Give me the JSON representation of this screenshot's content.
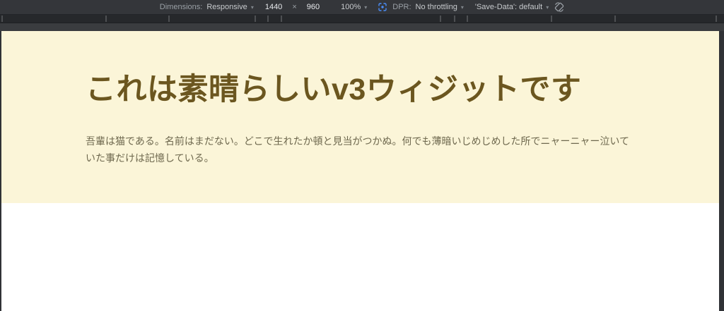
{
  "toolbar": {
    "dimensions_label": "Dimensions:",
    "dimensions_value": "Responsive",
    "width_value": "1440",
    "times_symbol": "×",
    "height_value": "960",
    "zoom_value": "100%",
    "dpr_label": "DPR:",
    "throttling_value": "No throttling",
    "save_data_value": "'Save-Data': default"
  },
  "icons": {
    "chevron_down": "▾",
    "focus_icon_name": "focus-icon",
    "rotate_icon_name": "rotate-viewport-icon"
  },
  "page": {
    "heading": "これは素晴らしいv3ウィジットです",
    "paragraph": "吾輩は猫である。名前はまだない。どこで生れたか頓と見当がつかぬ。何でも薄暗いじめじめした所でニャーニャー泣いていた事だけは記憶している。"
  },
  "colors": {
    "toolbar_bg": "#34363a",
    "toolbar_text": "#9aa0a6",
    "toolbar_value_text": "#e8eaed",
    "tabstrip_bg": "#26282b",
    "subbar_bg": "#3a3c3f",
    "accent_blue": "#4a8df8",
    "hero_bg": "#fbf5d8",
    "heading_color": "#6b561f",
    "paragraph_color": "#6e684e",
    "page_bg": "#ffffff"
  }
}
